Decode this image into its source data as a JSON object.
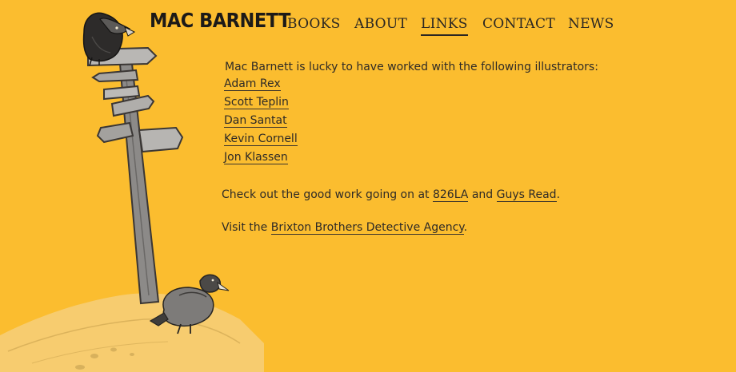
{
  "site": {
    "title": "MAC BARNETT"
  },
  "nav": {
    "items": [
      {
        "label": "BOOKS"
      },
      {
        "label": "ABOUT"
      },
      {
        "label": "LINKS"
      },
      {
        "label": "CONTACT"
      },
      {
        "label": "NEWS"
      }
    ],
    "active": "LINKS"
  },
  "content": {
    "intro": "Mac Barnett is lucky to have worked with the following illustrators:",
    "illustrators": [
      "Adam Rex",
      "Scott Teplin",
      "Dan Santat",
      "Kevin Cornell",
      "Jon Klassen"
    ],
    "check_out": {
      "prefix": "Check out the good work going on at",
      "link1": "826LA",
      "middle": "and",
      "link2": "Guys Read",
      "suffix": "."
    },
    "visit": {
      "prefix": "Visit the",
      "link": "Brixton Brothers Detective Agency",
      "suffix": "."
    }
  },
  "colors": {
    "background": "#fbbd2f",
    "ink": "#2e2a26"
  }
}
